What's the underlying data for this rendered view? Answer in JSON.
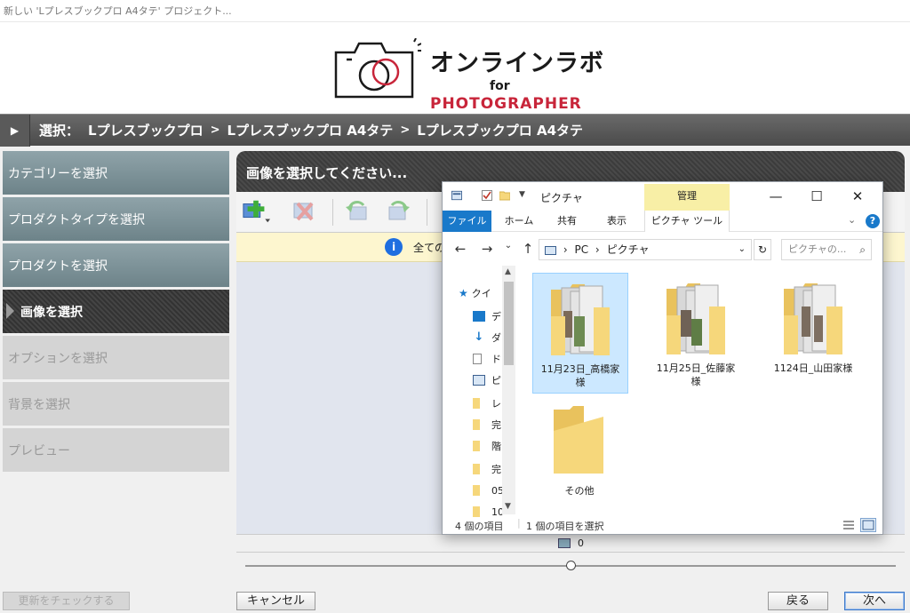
{
  "window": {
    "title": "新しい 'Lプレスブックプロ A4タテ' プロジェクト..."
  },
  "logo": {
    "jp": "オンラインラボ",
    "for": "for",
    "en": "PHOTOGRAPHER"
  },
  "breadcrumb": {
    "label": "選択：",
    "items": [
      "Lプレスブックプロ",
      "Lプレスブックプロ A4タテ",
      "Lプレスブックプロ A4タテ"
    ],
    "separator": ">"
  },
  "sidebar": {
    "items": [
      {
        "label": "カテゴリーを選択",
        "state": "done"
      },
      {
        "label": "プロダクトタイプを選択",
        "state": "done"
      },
      {
        "label": "プロダクトを選択",
        "state": "done"
      },
      {
        "label": "画像を選択",
        "state": "active"
      },
      {
        "label": "オプションを選択",
        "state": "todo"
      },
      {
        "label": "背景を選択",
        "state": "todo"
      },
      {
        "label": "プレビュー",
        "state": "todo"
      }
    ]
  },
  "main": {
    "heading": "画像を選択してください...",
    "info_text": "全ての",
    "count": "0"
  },
  "buttons": {
    "check_updates": "更新をチェックする",
    "cancel": "キャンセル",
    "back": "戻る",
    "next": "次へ"
  },
  "explorer": {
    "title": "ピクチャ",
    "manage_tab": "管理",
    "ribbon_tabs": [
      "ファイル",
      "ホーム",
      "共有",
      "表示",
      "ピクチャ ツール"
    ],
    "address": [
      "PC",
      "ピクチャ"
    ],
    "search_placeholder": "ピクチャの...",
    "nav_items": [
      {
        "label": "クイ",
        "icon": "star-icon"
      },
      {
        "label": "デ",
        "icon": "desktop-icon"
      },
      {
        "label": "ダ",
        "icon": "download-icon"
      },
      {
        "label": "ド",
        "icon": "document-icon"
      },
      {
        "label": "ピ",
        "icon": "pictures-icon"
      },
      {
        "label": "レ",
        "icon": "folder-icon"
      },
      {
        "label": "完",
        "icon": "folder-icon"
      },
      {
        "label": "階",
        "icon": "folder-icon"
      },
      {
        "label": "完",
        "icon": "folder-icon"
      },
      {
        "label": "05",
        "icon": "folder-icon"
      },
      {
        "label": "10",
        "icon": "folder-icon"
      }
    ],
    "files": [
      {
        "name_line1": "11月23日_高橋家",
        "name_line2": "様",
        "thumb": true,
        "selected": true
      },
      {
        "name_line1": "11月25日_佐藤家",
        "name_line2": "様",
        "thumb": true,
        "selected": false
      },
      {
        "name_line1": "1124日_山田家様",
        "name_line2": "",
        "thumb": true,
        "selected": false
      },
      {
        "name_line1": "その他",
        "name_line2": "",
        "thumb": false,
        "selected": false
      }
    ],
    "status_count": "4 個の項目",
    "status_selected": "1 個の項目を選択"
  },
  "colors": {
    "accent_blue": "#1979ca",
    "logo_red": "#c8253a",
    "folder_yellow": "#f6d77b",
    "selection_blue": "#cce8ff",
    "sidebar_done": "#7f959b"
  }
}
